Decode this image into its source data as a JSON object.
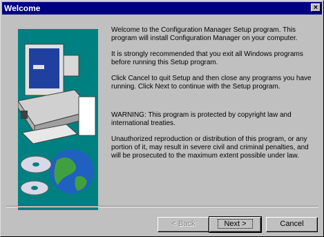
{
  "window": {
    "title": "Welcome",
    "close_glyph": "×"
  },
  "content": {
    "para1": "Welcome to the Configuration Manager Setup program.  This program will install Configuration Manager on your computer.",
    "para2": "It is strongly recommended that you exit all Windows programs before running this Setup program.",
    "para3": "Click Cancel to quit Setup and then close any programs you have running.  Click Next to continue with the Setup program.",
    "para4": "WARNING: This program is protected by copyright law and international treaties.",
    "para5": "Unauthorized reproduction or distribution of this program, or any portion of it, may result in severe civil and criminal penalties, and will be prosecuted to the maximum extent possible under law."
  },
  "buttons": {
    "back": "< Back",
    "next": "Next >",
    "cancel": "Cancel"
  },
  "colors": {
    "titlebar": "#000080",
    "art_bg": "#008080",
    "dialog_bg": "#c0c0c0"
  },
  "icons": [
    "close-icon",
    "computer-icon",
    "cd-icon",
    "globe-icon"
  ]
}
